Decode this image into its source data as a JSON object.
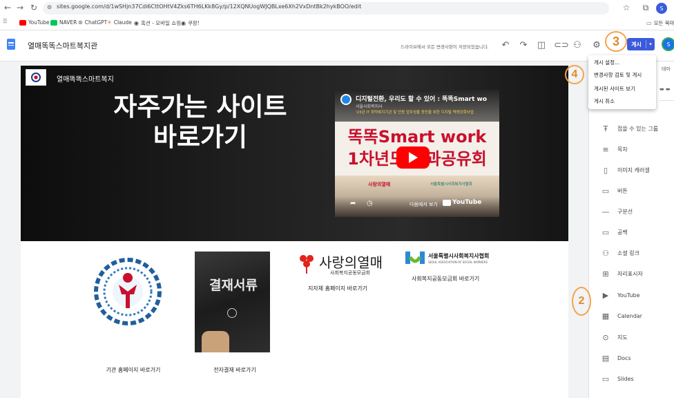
{
  "browser": {
    "url": "sites.google.com/d/1wSHjn37Cdi6CttOHtV4Zks6TH6LKk8Gy/p/12XQNUogWJQBLxe6Xh2VxDntBk2hykBOO/edit",
    "bookmarks": [
      "YouTube",
      "NAVER",
      "ChatGPT",
      "Claude",
      "혹션 - 모바일 쇼핑...",
      "쿠팡!"
    ],
    "all_bookmarks_label": "모든 북마",
    "profile_initial": "S"
  },
  "editor": {
    "site_title": "열매똑똑스마트복지관",
    "save_status": "드라이브에서 모든 변경사항이 저장되었습니다.",
    "publish_label": "게시",
    "avatar_initial": "S",
    "theme_tab": "테마"
  },
  "publish_menu": {
    "items": [
      "게시 설정...",
      "변경사항 검토 및 게시",
      "게시된 사이트 보기",
      "게시 취소"
    ]
  },
  "annotations": {
    "n2": "2",
    "n3": "3",
    "n4": "4"
  },
  "hero": {
    "site_name": "열매똑똑스마트복지",
    "heading_line1": "자주가는 사이트",
    "heading_line2": "바로가기",
    "video_title": "디지털전환, 우리도 할 수 있어 : 똑똑Smart wo",
    "video_channel": "서울사회복지사",
    "video_subline": "'23년 IT 취약복지기관 및 단원 업무성을 증진을 위한 디지털 역량강화사업",
    "video_big1": "똑똑Smart work",
    "video_big2": "1차년도 성과공유회",
    "watch_on": "다음에서 보기",
    "youtube_word": "YouTube",
    "sponsor1": "사랑의열매",
    "sponsor2": "서울특별시사회복지사협회"
  },
  "links": {
    "link1_caption": "기관 홈페이지 바로가기",
    "link2_caption": "전자결재 바로가기",
    "link2_image_text": "결재서류",
    "link3_logo": "사랑의열매",
    "link3_sub": "사회복지공동모금회",
    "link3_caption": "지자체 홈페이지 바로가기",
    "link4_logo": "서울특별시사회복지사협회",
    "link4_sub": "SEOUL ASSOCIATION OF SOCIAL WORKERS",
    "link4_caption": "사회복지공동모금회 바로가기"
  },
  "insert_panel": {
    "items": [
      {
        "icon": "collapsible-group-icon",
        "glyph": "Ŧ",
        "label": "접을 수 있는 그룹"
      },
      {
        "icon": "toc-icon",
        "glyph": "≡",
        "label": "목차"
      },
      {
        "icon": "image-carousel-icon",
        "glyph": "▯",
        "label": "이미지 캐러셀"
      },
      {
        "icon": "button-icon",
        "glyph": "▭",
        "label": "버튼"
      },
      {
        "icon": "divider-icon",
        "glyph": "—",
        "label": "구분선"
      },
      {
        "icon": "spacer-icon",
        "glyph": "▭",
        "label": "공백"
      },
      {
        "icon": "social-links-icon",
        "glyph": "⚇",
        "label": "소셜 링크"
      },
      {
        "icon": "placeholder-icon",
        "glyph": "⊞",
        "label": "자리표시자"
      },
      {
        "icon": "youtube-icon",
        "glyph": "▶",
        "label": "YouTube"
      },
      {
        "icon": "calendar-icon",
        "glyph": "▦",
        "label": "Calendar"
      },
      {
        "icon": "map-icon",
        "glyph": "⊙",
        "label": "지도"
      },
      {
        "icon": "docs-icon",
        "glyph": "▤",
        "label": "Docs"
      },
      {
        "icon": "slides-icon",
        "glyph": "▭",
        "label": "Slides"
      }
    ]
  },
  "colors": {
    "accent_blue": "#3b5bdb",
    "annotation_orange": "#f5a34b",
    "youtube_red": "#ff0000",
    "video_title_red": "#c8102e"
  }
}
